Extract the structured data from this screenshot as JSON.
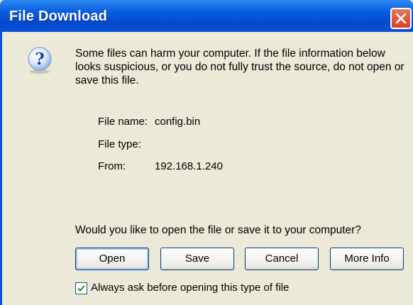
{
  "window": {
    "title": "File Download"
  },
  "message": {
    "warning": "Some files can harm your computer. If the file information below looks suspicious, or you do not fully trust the source, do not open or save this file.",
    "icon": "question-icon"
  },
  "file_info": {
    "name_label": "File name:",
    "name_value": "config.bin",
    "type_label": "File type:",
    "type_value": "",
    "from_label": "From:",
    "from_value": "192.168.1.240"
  },
  "prompt": "Would you like to open the file or save it to your computer?",
  "buttons": {
    "open": "Open",
    "save": "Save",
    "cancel": "Cancel",
    "more_info": "More Info"
  },
  "always_ask": {
    "label": "Always ask before opening this type of file",
    "checked": true
  },
  "colors": {
    "titlebar": "#0a5fe0",
    "close_button": "#d6432a",
    "dialog_background": "#ece9d8"
  }
}
